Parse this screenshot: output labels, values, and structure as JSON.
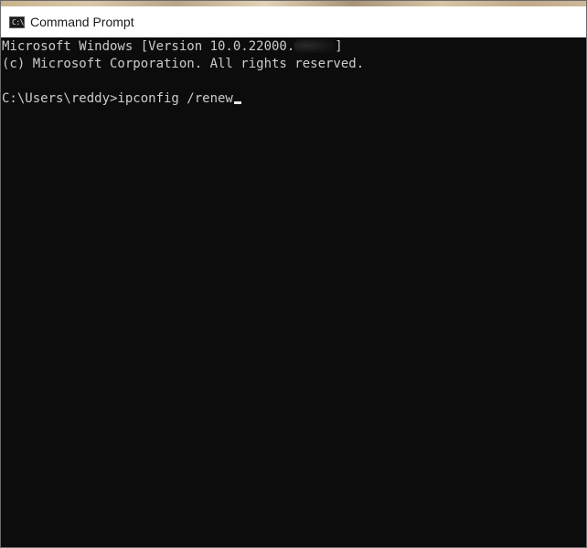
{
  "window": {
    "title": "Command Prompt",
    "app_icon": "command-prompt-icon",
    "app_icon_glyph": "C:\\"
  },
  "console": {
    "lines": [
      {
        "prefix": "Microsoft Windows [Version 10.0.22000.",
        "suffix": "]",
        "redacted": true
      },
      {
        "text": "(c) Microsoft Corporation. All rights reserved."
      },
      {
        "text": ""
      },
      {
        "text": "C:\\Users\\reddy>ipconfig /renew"
      }
    ]
  },
  "colors": {
    "console_background": "#0c0c0c",
    "console_text": "#cccccc",
    "titlebar_background": "#ffffff"
  }
}
